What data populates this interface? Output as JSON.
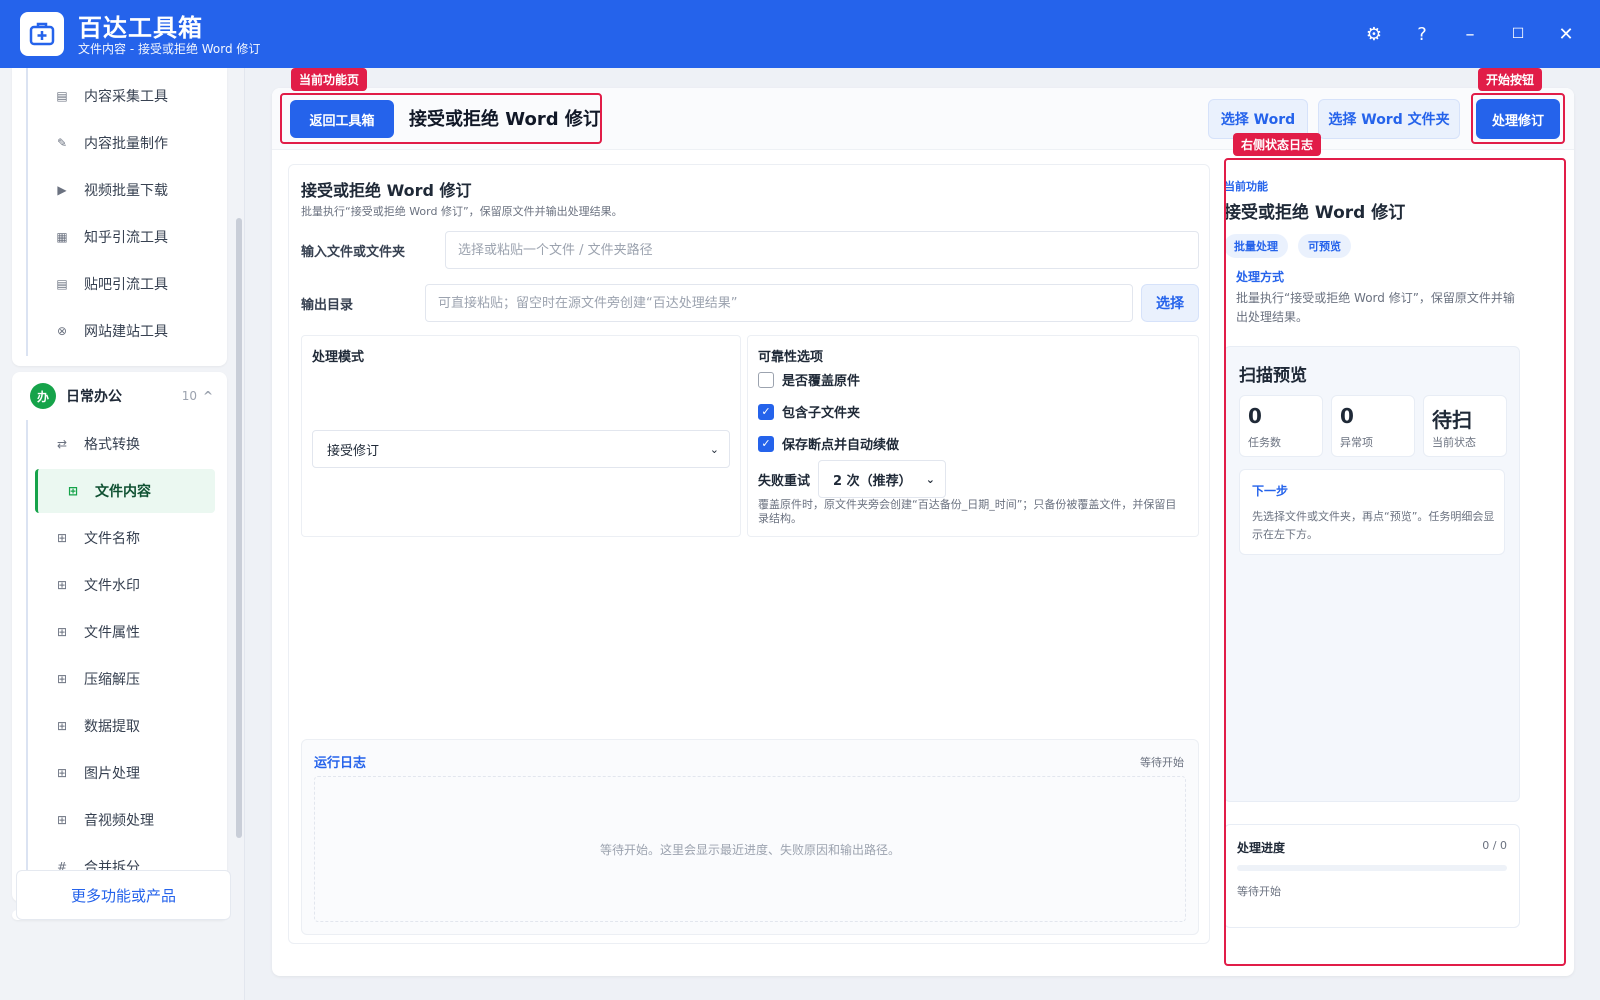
{
  "app": {
    "title": "百达工具箱",
    "subtitle": "文件内容 - 接受或拒绝 Word 修订"
  },
  "window": {
    "settings": "⚙",
    "help": "?",
    "minimize": "–",
    "maximize": "☐",
    "close": "✕"
  },
  "sidebar": {
    "top_items": [
      {
        "label": "内容采集工具",
        "icon": "▤"
      },
      {
        "label": "内容批量制作",
        "icon": "✎"
      },
      {
        "label": "视频批量下载",
        "icon": "▶"
      },
      {
        "label": "知乎引流工具",
        "icon": "▦"
      },
      {
        "label": "贴吧引流工具",
        "icon": "▤"
      },
      {
        "label": "网站建站工具",
        "icon": "⊗"
      }
    ],
    "group": {
      "badge": "办",
      "name": "日常办公",
      "count": "10",
      "caret": "^"
    },
    "group_items": [
      {
        "label": "格式转换",
        "icon": "⇄"
      },
      {
        "label": "文件内容",
        "icon": "⊞"
      },
      {
        "label": "文件名称",
        "icon": "⊞"
      },
      {
        "label": "文件水印",
        "icon": "⊞"
      },
      {
        "label": "文件属性",
        "icon": "⊞"
      },
      {
        "label": "压缩解压",
        "icon": "⊞"
      },
      {
        "label": "数据提取",
        "icon": "⊞"
      },
      {
        "label": "图片处理",
        "icon": "⊞"
      },
      {
        "label": "音视频处理",
        "icon": "⊞"
      },
      {
        "label": "合并拆分",
        "icon": "#"
      }
    ],
    "active_item": "文件内容",
    "more": "更多功能或产品"
  },
  "toolbar": {
    "back": "返回工具箱",
    "title": "接受或拒绝 Word 修订",
    "select_word": "选择 Word",
    "select_folder": "选择 Word 文件夹",
    "process": "处理修订"
  },
  "callouts": {
    "current_page": "当前功能页",
    "start_button": "开始按钮",
    "status_log": "右侧状态日志"
  },
  "form": {
    "title": "接受或拒绝 Word 修订",
    "desc": "批量执行“接受或拒绝 Word 修订”，保留原文件并输出处理结果。",
    "input_label": "输入文件或文件夹",
    "input_placeholder": "选择或粘贴一个文件 / 文件夹路径",
    "output_label": "输出目录",
    "output_placeholder": "可直接粘贴；留空时在源文件旁创建“百达处理结果”",
    "output_btn": "选择",
    "mode_title": "处理模式",
    "mode_value": "接受修订",
    "reliability_title": "可靠性选项",
    "opt_overwrite": "是否覆盖原件",
    "opt_subfolders": "包含子文件夹",
    "opt_resume": "保存断点并自动续做",
    "overwrite_checked": false,
    "subfolders_checked": true,
    "resume_checked": true,
    "retry_label": "失败重试",
    "retry_value": "2 次（推荐）",
    "hint": "覆盖原件时，原文件夹旁会创建“百达备份_日期_时间”；只备份被覆盖文件，并保留目录结构。"
  },
  "log": {
    "title": "运行日志",
    "state": "等待开始",
    "empty": "等待开始。这里会显示最近进度、失败原因和输出路径。"
  },
  "status": {
    "label": "当前功能",
    "title": "接受或拒绝 Word 修订",
    "chips": [
      "批量处理",
      "可预览"
    ],
    "method_title": "处理方式",
    "method_desc": "批量执行“接受或拒绝 Word 修订”，保留原文件并输出处理结果。",
    "scan_title": "扫描预览",
    "stats": [
      {
        "value": "0",
        "label": "任务数"
      },
      {
        "value": "0",
        "label": "异常项"
      },
      {
        "value": "待扫",
        "label": "当前状态"
      }
    ],
    "next_title": "下一步",
    "next_desc": "先选择文件或文件夹，再点“预览”。任务明细会显示在左下方。",
    "progress_title": "处理进度",
    "progress_count": "0 / 0",
    "progress_fraction": 0,
    "progress_state": "等待开始"
  },
  "colors": {
    "primary": "#2563eb",
    "active_green": "#16a34a",
    "callout_red": "#e11d48"
  }
}
